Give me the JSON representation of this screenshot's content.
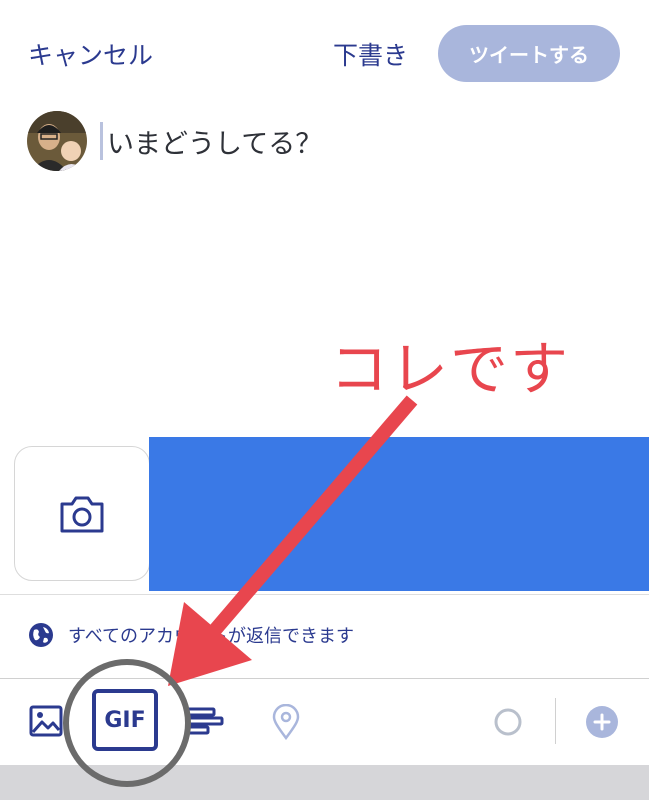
{
  "header": {
    "cancel_label": "キャンセル",
    "draft_label": "下書き",
    "tweet_label": "ツイートする"
  },
  "composer": {
    "placeholder": "いまどうしてる？"
  },
  "reply_setting": {
    "text": "すべてのアカウントが返信できます",
    "icon": "globe-icon"
  },
  "toolbar": {
    "items": [
      "image-icon",
      "gif-icon",
      "poll-icon",
      "location-icon",
      "progress-circle-icon",
      "add-icon"
    ],
    "gif_label": "GIF"
  },
  "annotation": {
    "label": "コレです",
    "color": "#e8464e"
  },
  "colors": {
    "accent": "#2b3a8f",
    "tweet_button_disabled": "#a9b6dc",
    "media_placeholder": "#3a79e6"
  }
}
